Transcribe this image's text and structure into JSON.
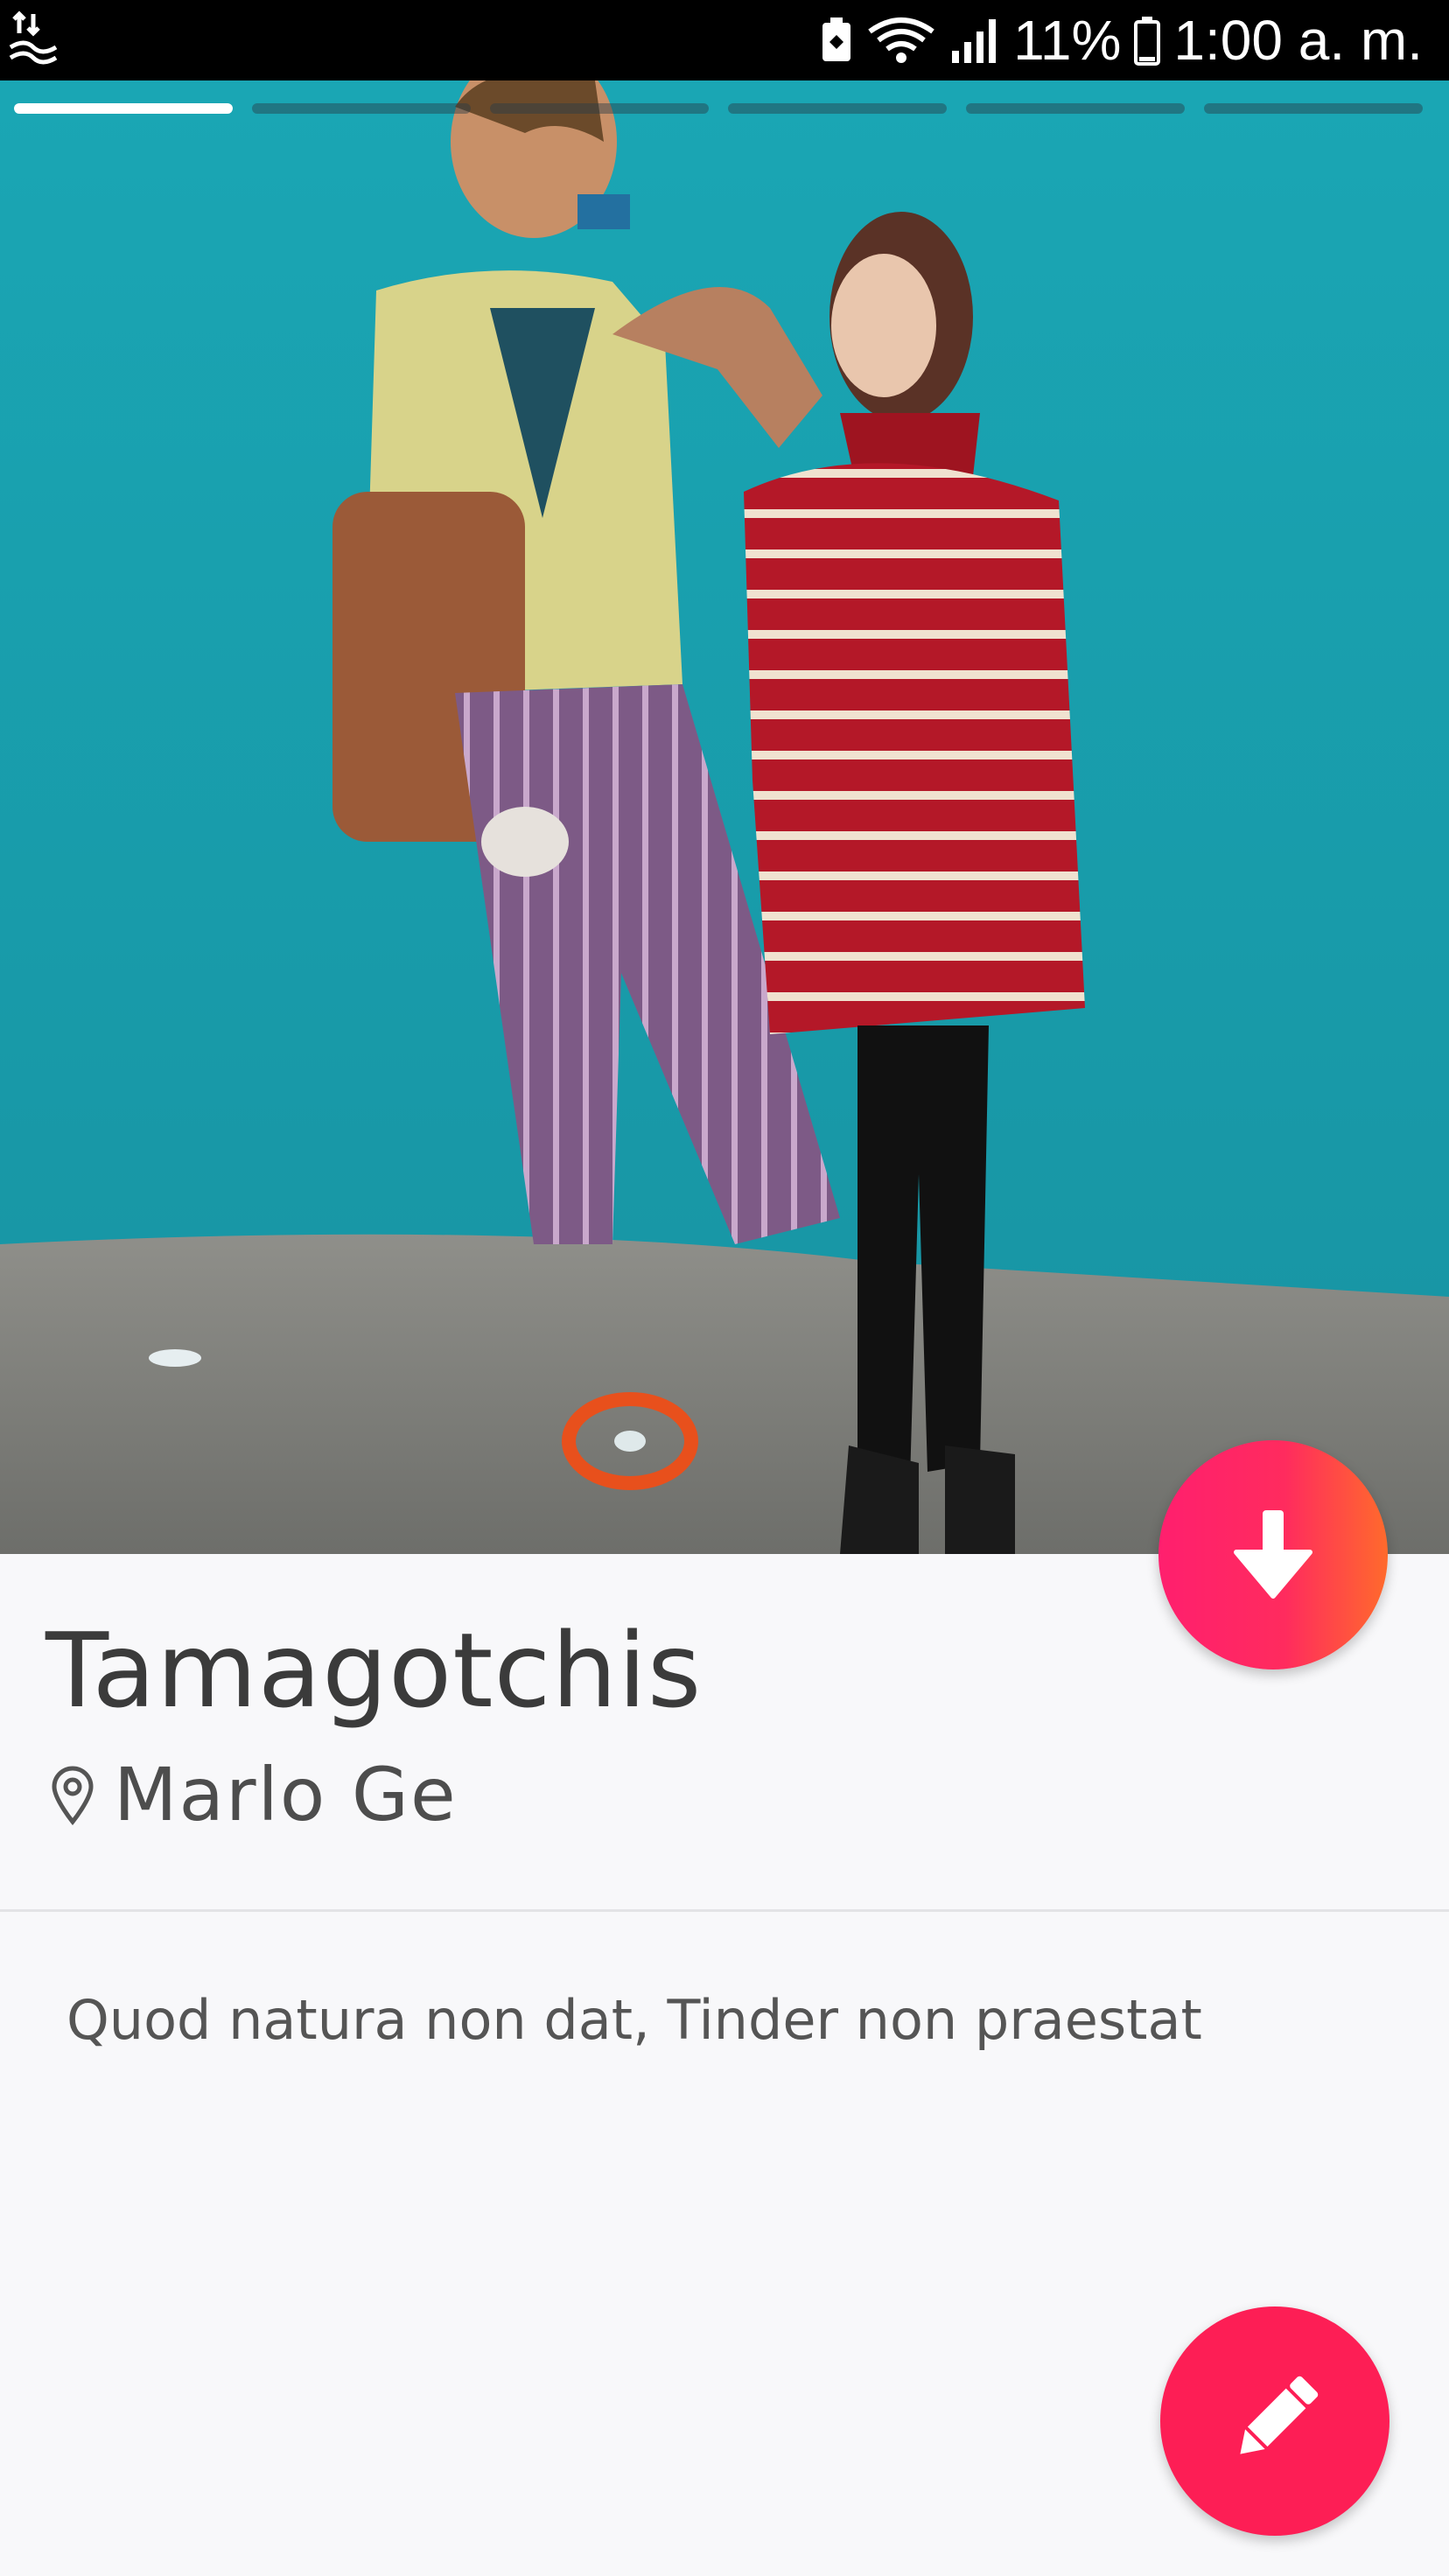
{
  "status_bar": {
    "battery_percent": "11%",
    "time": "1:00 a. m.",
    "icons": [
      "data-transfer-icon",
      "battery-saver-icon",
      "wifi-icon",
      "signal-icon",
      "battery-icon"
    ]
  },
  "photo": {
    "progress_segments": 6,
    "active_segment": 1
  },
  "profile": {
    "name": "Tamagotchis",
    "location": "Marlo Ge",
    "bio": "Quod natura non dat, Tinder non praestat"
  },
  "buttons": {
    "down_icon": "arrow-down-icon",
    "edit_icon": "pencil-icon"
  },
  "colors": {
    "accent": "#fd1e55",
    "gradient_end": "#ff6a2c",
    "wall": "#1fa4b2"
  }
}
